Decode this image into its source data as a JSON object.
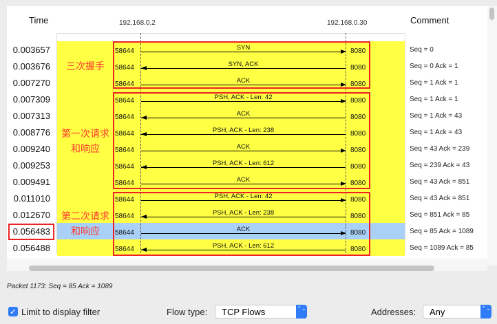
{
  "headers": {
    "time": "Time",
    "comment": "Comment",
    "host_a": "192.168.0.2",
    "host_b": "192.168.0.30"
  },
  "colors": {
    "row": "#ffff44",
    "selected_row": "#a9d1f7",
    "highlight": "#ee2222",
    "group_label": "#ff3b30"
  },
  "rows": [
    {
      "time": "0.003657",
      "label": "SYN",
      "dir": "right",
      "src_port": "58644",
      "dst_port": "8080",
      "comment": "Seq = 0"
    },
    {
      "time": "0.003676",
      "label": "SYN, ACK",
      "dir": "left",
      "src_port": "58644",
      "dst_port": "8080",
      "comment": "Seq = 0 Ack = 1"
    },
    {
      "time": "0.007270",
      "label": "ACK",
      "dir": "right",
      "src_port": "58644",
      "dst_port": "8080",
      "comment": "Seq = 1 Ack = 1"
    },
    {
      "time": "0.007309",
      "label": "PSH, ACK - Len: 42",
      "dir": "right",
      "src_port": "58644",
      "dst_port": "8080",
      "comment": "Seq = 1 Ack = 1"
    },
    {
      "time": "0.007313",
      "label": "ACK",
      "dir": "left",
      "src_port": "58644",
      "dst_port": "8080",
      "comment": "Seq = 1 Ack = 43"
    },
    {
      "time": "0.008776",
      "label": "PSH, ACK - Len: 238",
      "dir": "left",
      "src_port": "58644",
      "dst_port": "8080",
      "comment": "Seq = 1 Ack = 43"
    },
    {
      "time": "0.009240",
      "label": "ACK",
      "dir": "right",
      "src_port": "58644",
      "dst_port": "8080",
      "comment": "Seq = 43 Ack = 239"
    },
    {
      "time": "0.009253",
      "label": "PSH, ACK - Len: 612",
      "dir": "left",
      "src_port": "58644",
      "dst_port": "8080",
      "comment": "Seq = 239 Ack = 43"
    },
    {
      "time": "0.009491",
      "label": "ACK",
      "dir": "right",
      "src_port": "58644",
      "dst_port": "8080",
      "comment": "Seq = 43 Ack = 851"
    },
    {
      "time": "0.011010",
      "label": "PSH, ACK - Len: 42",
      "dir": "right",
      "src_port": "58644",
      "dst_port": "8080",
      "comment": "Seq = 43 Ack = 851"
    },
    {
      "time": "0.012670",
      "label": "PSH, ACK - Len: 238",
      "dir": "left",
      "src_port": "58644",
      "dst_port": "8080",
      "comment": "Seq = 851 Ack = 85"
    },
    {
      "time": "0.056483",
      "label": "ACK",
      "dir": "right",
      "src_port": "58644",
      "dst_port": "8080",
      "comment": "Seq = 85 Ack = 1089",
      "selected": true
    },
    {
      "time": "0.056488",
      "label": "PSH, ACK - Len: 612",
      "dir": "left",
      "src_port": "58644",
      "dst_port": "8080",
      "comment": "Seq = 1089 Ack = 85"
    }
  ],
  "groups": [
    {
      "line1": "三次握手",
      "line2": ""
    },
    {
      "line1": "第一次请求",
      "line2": "和响应"
    },
    {
      "line1": "第二次请求",
      "line2": "和响应"
    }
  ],
  "status": "Packet 1173: Seq = 85 Ack = 1089",
  "controls": {
    "limit_label": "Limit to display filter",
    "limit_checked": true,
    "flow_type_label": "Flow type:",
    "flow_type_value": "TCP Flows",
    "addresses_label": "Addresses:",
    "addresses_value": "Any",
    "check_glyph": "✓",
    "stepper_glyph": "⌃⌄"
  }
}
